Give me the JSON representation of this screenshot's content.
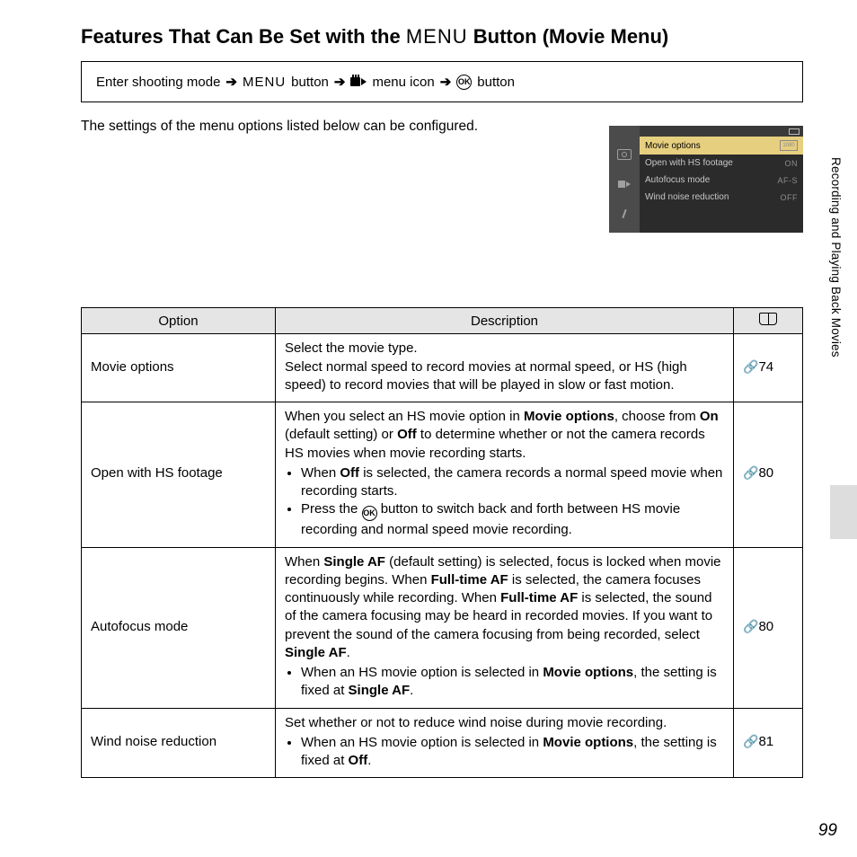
{
  "title_part1": "Features That Can Be Set with the ",
  "title_menu": "MENU",
  "title_part2": " Button (Movie Menu)",
  "nav": {
    "enter": "Enter shooting mode",
    "menu_button": "MENU",
    "button_word": " button",
    "menu_icon_word": " menu icon",
    "ok_button_word": " button"
  },
  "intro": "The settings of the menu options listed below can be configured.",
  "screen": {
    "rows": [
      {
        "label": "Movie options",
        "val": ""
      },
      {
        "label": "Open with HS footage",
        "val": "ON"
      },
      {
        "label": "Autofocus mode",
        "val": "AF-S"
      },
      {
        "label": "Wind noise reduction",
        "val": "OFF"
      }
    ]
  },
  "headers": {
    "option": "Option",
    "description": "Description"
  },
  "rows": [
    {
      "option": "Movie options",
      "ref": "74",
      "para": "Select the movie type.\nSelect normal speed to record movies at normal speed, or HS (high speed) to record movies that will be played in slow or fast motion."
    },
    {
      "option": "Open with HS footage",
      "ref": "80",
      "para_html": "When you select an HS movie option in <b>Movie options</b>, choose from <b>On</b> (default setting) or <b>Off</b> to determine whether or not the camera records HS movies when movie recording starts.",
      "bullets_html": [
        "When <b>Off</b> is selected, the camera records a normal speed movie when recording starts.",
        "Press the <span class=\"icon-ok\">OK</span> button to switch back and forth between HS movie recording and normal speed movie recording."
      ]
    },
    {
      "option": "Autofocus mode",
      "ref": "80",
      "para_html": "When <b>Single AF</b> (default setting) is selected, focus is locked when movie recording begins. When <b>Full-time AF</b> is selected, the camera focuses continuously while recording. When <b>Full-time AF</b> is selected, the sound of the camera focusing may be heard in recorded movies. If you want to prevent the sound of the camera focusing from being recorded, select <b>Single AF</b>.",
      "bullets_html": [
        "When an HS movie option is selected in <b>Movie options</b>, the setting is fixed at <b>Single AF</b>."
      ]
    },
    {
      "option": "Wind noise reduction",
      "ref": "81",
      "para_html": "Set whether or not to reduce wind noise during movie recording.",
      "bullets_html": [
        "When an HS movie option is selected in <b>Movie options</b>, the setting is fixed at <b>Off</b>."
      ]
    }
  ],
  "side_label": "Recording and Playing Back Movies",
  "page_num": "99"
}
